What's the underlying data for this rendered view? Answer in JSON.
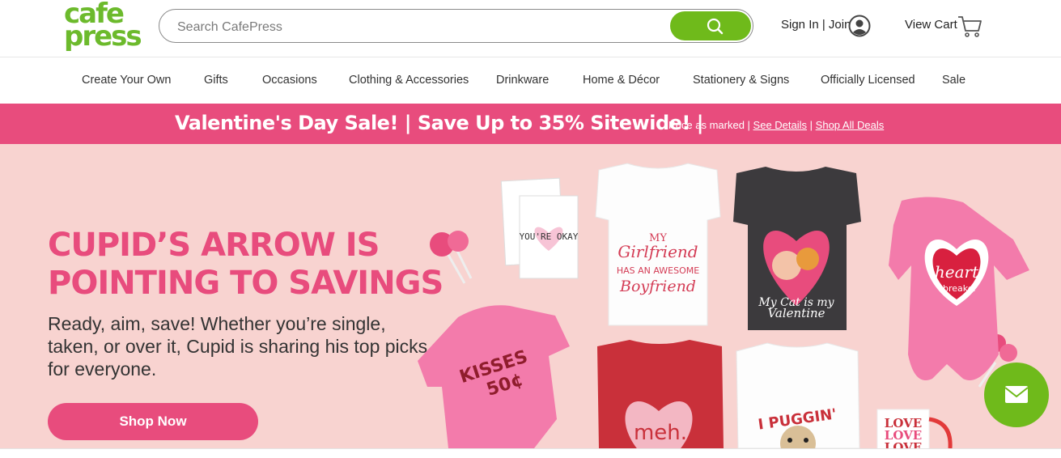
{
  "header": {
    "logo_line1": "cafe",
    "logo_line2": "press",
    "search_placeholder": "Search CafePress",
    "signin_label": "Sign In | Join",
    "cart_label": "View Cart"
  },
  "nav": {
    "items": [
      {
        "label": "Create Your Own"
      },
      {
        "label": "Gifts"
      },
      {
        "label": "Occasions"
      },
      {
        "label": "Clothing & Accessories"
      },
      {
        "label": "Drinkware"
      },
      {
        "label": "Home & Décor"
      },
      {
        "label": "Stationery & Signs"
      },
      {
        "label": "Officially Licensed"
      },
      {
        "label": "Sale"
      }
    ]
  },
  "promo": {
    "headline": "Valentine's Day Sale! | Save Up to 35% Sitewide! |",
    "price_note": "Price as marked |",
    "see_details": "See Details",
    "separator": "|",
    "shop_all_deals": "Shop All Deals"
  },
  "hero": {
    "headline_line1": "CUPID’S ARROW IS",
    "headline_line2": "POINTING TO SAVINGS",
    "body": "Ready, aim, save! Whether you’re single, taken, or over it, Cupid is sharing his top picks for everyone.",
    "cta_label": "Shop Now",
    "product_texts": {
      "card": "YOU'RE OKAY",
      "tee1_line1": "MY",
      "tee1_line2": "Girlfriend",
      "tee1_line3": "HAS AN AWESOME",
      "tee1_line4": "Boyfriend",
      "tee2_line1": "My Cat is my",
      "tee2_line2": "Valentine",
      "onesie1_line1": "heart",
      "onesie1_line2": "breaker",
      "onesie2_line1": "KISSES",
      "onesie2_line2": "50¢",
      "tee3": "meh.",
      "tee4": "I PUGGIN'",
      "mug_line1": "LOVE",
      "mug_line2": "LOVE",
      "mug_line3": "LOVE"
    }
  },
  "colors": {
    "brand_green": "#6fba1b",
    "promo_pink": "#e84c7d",
    "hero_bg": "#f8d3d0"
  }
}
